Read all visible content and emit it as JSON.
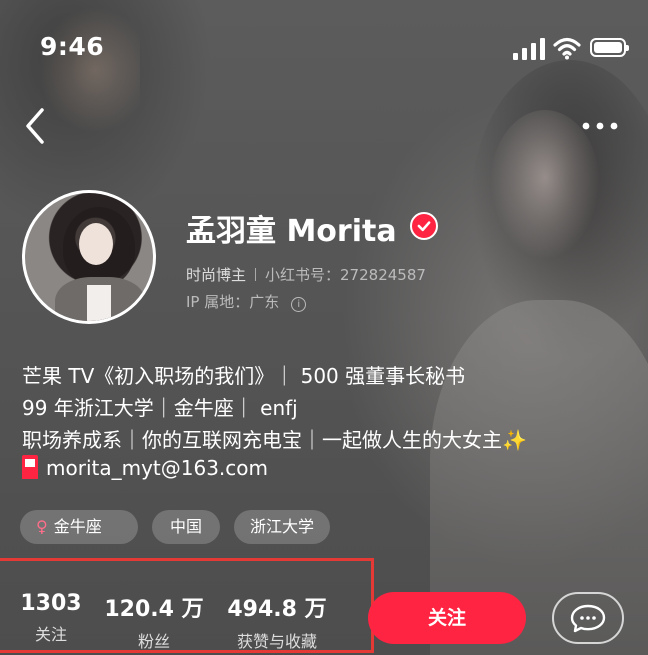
{
  "status_bar": {
    "time": "9:46"
  },
  "header": {
    "back_icon": "chevron-left-icon",
    "more_icon": "ellipsis-icon"
  },
  "profile": {
    "name": "孟羽童 Morita",
    "verified": true,
    "role": "时尚博主",
    "red_id": "小红书号：272824587",
    "ip_location": "IP 属地：广东"
  },
  "bio": {
    "line1": "芒果 TV《初入职场的我们》｜ 500 强董事长秘书",
    "line2": "99 年浙江大学｜金牛座｜ enfj",
    "line3": "职场养成系｜你的互联网充电宝｜一起做人生的大女主",
    "sparkle": "✨",
    "email": "morita_myt@163.com"
  },
  "tags": [
    "金牛座",
    "中国",
    "浙江大学"
  ],
  "stats": [
    {
      "value": "1303",
      "label": "关注"
    },
    {
      "value": "120.4 万",
      "label": "粉丝"
    },
    {
      "value": "494.8 万",
      "label": "获赞与收藏"
    }
  ],
  "actions": {
    "follow_label": "关注",
    "chat_icon": "chat-bubble-icon"
  },
  "colors": {
    "brand_red": "#ff2442",
    "highlight_border": "#e53935"
  }
}
